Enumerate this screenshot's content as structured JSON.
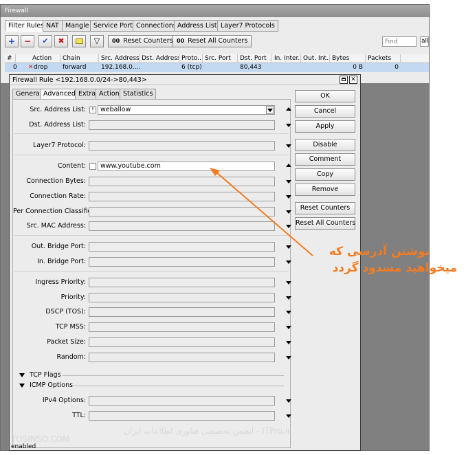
{
  "firewall": {
    "title": "Firewall",
    "tabs": [
      "Filter Rules",
      "NAT",
      "Mangle",
      "Service Ports",
      "Connections",
      "Address Lists",
      "Layer7 Protocols"
    ],
    "toolbar": {
      "add_symbol": "+",
      "remove_symbol": "−",
      "enable_symbol": "✔",
      "disable_symbol": "✖",
      "filter_symbol": "▽",
      "reset_counters_label": "Reset Counters",
      "reset_all_counters_label": "Reset All Counters",
      "counter_icon_text": "00",
      "find_placeholder": "Find",
      "all_select_value": "all"
    },
    "columns": [
      "#",
      "Action",
      "Chain",
      "Src. Address",
      "Dst. Address",
      "Proto...",
      "Src. Port",
      "Dst. Port",
      "In. Inter...",
      "Out. Int...",
      "Bytes",
      "Packets"
    ],
    "rows": [
      {
        "num": "0",
        "action": "drop",
        "chain": "forward",
        "src_address": "192.168.0....",
        "dst_address": "",
        "proto": "6 (tcp)",
        "src_port": "",
        "dst_port": "80,443",
        "in_interface": "",
        "out_interface": "",
        "bytes": "0 B",
        "packets": "0"
      }
    ]
  },
  "dialog": {
    "title": "Firewall Rule <192.168.0.0/24->80,443>",
    "tabs": [
      "General",
      "Advanced",
      "Extra",
      "Action",
      "Statistics"
    ],
    "fields": {
      "src_address_list": {
        "label": "Src. Address List:",
        "value": "weballow",
        "neg_symbol": "!"
      },
      "dst_address_list": {
        "label": "Dst. Address List:",
        "value": ""
      },
      "layer7_protocol": {
        "label": "Layer7 Protocol:",
        "value": ""
      },
      "content": {
        "label": "Content:",
        "value": "www.youtube.com"
      },
      "connection_bytes": {
        "label": "Connection Bytes:",
        "value": ""
      },
      "connection_rate": {
        "label": "Connection Rate:",
        "value": ""
      },
      "per_connection_classifier": {
        "label": "Per Connection Classifier:",
        "value": ""
      },
      "src_mac_address": {
        "label": "Src. MAC Address:",
        "value": ""
      },
      "out_bridge_port": {
        "label": "Out. Bridge Port:",
        "value": ""
      },
      "in_bridge_port": {
        "label": "In. Bridge Port:",
        "value": ""
      },
      "ingress_priority": {
        "label": "Ingress Priority:",
        "value": ""
      },
      "priority": {
        "label": "Priority:",
        "value": ""
      },
      "dscp": {
        "label": "DSCP (TOS):",
        "value": ""
      },
      "tcp_mss": {
        "label": "TCP MSS:",
        "value": ""
      },
      "packet_size": {
        "label": "Packet Size:",
        "value": ""
      },
      "random": {
        "label": "Random:",
        "value": ""
      },
      "ipv4_options": {
        "label": "IPv4 Options:",
        "value": ""
      },
      "ttl": {
        "label": "TTL:",
        "value": ""
      }
    },
    "sections": {
      "tcp_flags": "TCP Flags",
      "icmp_options": "ICMP Options"
    },
    "buttons": {
      "ok": "OK",
      "cancel": "Cancel",
      "apply": "Apply",
      "disable": "Disable",
      "comment": "Comment",
      "copy": "Copy",
      "remove": "Remove",
      "reset_counters": "Reset Counters",
      "reset_all_counters": "Reset All Counters"
    }
  },
  "status_text": "enabled",
  "annotation": {
    "line1": "نوشتن آدرسی که",
    "line2": "میخواهید مسدود گردد",
    "color": "#f47b20"
  },
  "watermarks": {
    "left": "TOSINSO.COM",
    "center": "ITPro.ir - انجمن تخصصی فناوری اطلاعات ایران"
  }
}
